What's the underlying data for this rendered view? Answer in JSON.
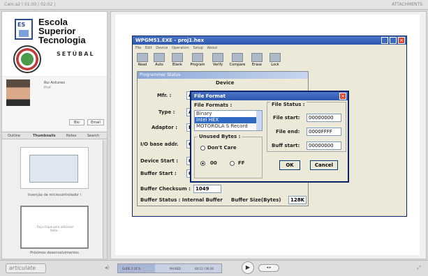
{
  "topbar": {
    "title": "Cam.a2  |  01:00 / 02:02 |",
    "attachments": "ATTACHMENTS"
  },
  "logo": {
    "line1": "Escola",
    "line2": "Superior",
    "line3": "Tecnologia",
    "city": "SETÚBAL"
  },
  "presenter": {
    "name": "Rui Antunes",
    "role": "Prof.",
    "bio_btn": "Bio",
    "email_btn": "Email"
  },
  "tabs": [
    "Outline",
    "Thumbnails",
    "Notes",
    "Search"
  ],
  "thumbs": [
    {
      "caption": "Inserção de microcontrolador i"
    },
    {
      "caption": "Próximos desenvolvimentos",
      "text": "Faça clique para adicionar texto..."
    }
  ],
  "app": {
    "title": "WPGM51.EXE - proj1.hex",
    "menu": [
      "File",
      "Edit",
      "Device",
      "Operation",
      "Setup",
      "About"
    ],
    "toolbar": [
      "Read",
      "Auto",
      "Blank",
      "Program",
      "Verify",
      "Compare",
      "Erase",
      "Lock"
    ],
    "status_title": "Programmer Status",
    "device_header": "Device",
    "mfr_label": "Mfr. :",
    "mfr_value": "AT",
    "type_label": "Type :",
    "type_value": "AT",
    "adaptor_label": "Adaptor :",
    "adaptor_value": "N",
    "io_label": "I/O base addr.",
    "io_value": "C",
    "dev_start_label": "Device Start :",
    "dev_start_value": "00",
    "buf_start_label": "Buffer Start :",
    "buf_start_value": "00",
    "checksum_label": "Buffer Checksum :",
    "checksum_value": "1049",
    "buf_status_label": "Buffer Status : Internal Buffer",
    "buf_size_label": "Buffer Size(Bytes)",
    "buf_size_value": "128K"
  },
  "dialog": {
    "title": "File Format",
    "formats_label": "File Formats :",
    "formats": [
      "Binary",
      "Intel HEX",
      "MOTOROLA S Record"
    ],
    "selected": "Intel HEX",
    "status_label": "File Status :",
    "file_start_label": "File start:",
    "file_start_value": "00000000",
    "file_end_label": "File end:",
    "file_end_value": "0000FFFF",
    "buff_start_label": "Buff start:",
    "buff_start_value": "00000000",
    "unused_label": "Unused Bytes :",
    "dont_care": "Don't Care",
    "opt_00": "00",
    "opt_ff": "FF",
    "ok": "OK",
    "cancel": "Cancel"
  },
  "player": {
    "logo": "articulate",
    "slide_info": "SLIDE 2 OF 6",
    "state": "PAUSED",
    "time": "00:13 / 00:36"
  },
  "colors": {
    "title_blue": "#2d58ad",
    "selection": "#316ac5",
    "close_red": "#d7472e"
  }
}
